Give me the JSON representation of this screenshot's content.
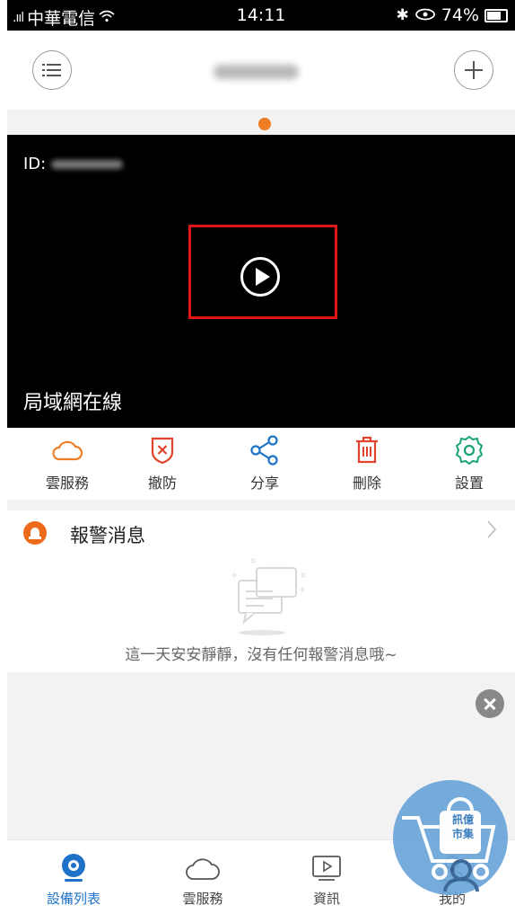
{
  "status_bar": {
    "carrier": "中華電信",
    "time": "14:11",
    "battery": "74%"
  },
  "video": {
    "id_label": "ID:",
    "status": "局域網在線"
  },
  "actions": [
    {
      "label": "雲服務",
      "icon": "cloud-icon"
    },
    {
      "label": "撤防",
      "icon": "shield-x-icon"
    },
    {
      "label": "分享",
      "icon": "share-icon"
    },
    {
      "label": "刪除",
      "icon": "trash-icon"
    },
    {
      "label": "設置",
      "icon": "settings-icon"
    }
  ],
  "alarm": {
    "title": "報警消息",
    "empty_text": "這一天安安靜靜，沒有任何報警消息哦~"
  },
  "market": {
    "line1": "訊億",
    "line2": "市集"
  },
  "tabs": [
    {
      "label": "設備列表",
      "icon": "camera-icon",
      "active": true
    },
    {
      "label": "雲服務",
      "icon": "cloud-icon"
    },
    {
      "label": "資訊",
      "icon": "video-play-icon"
    },
    {
      "label": "我的",
      "icon": "user-icon"
    }
  ],
  "colors": {
    "accent_orange": "#ee7d24",
    "accent_blue": "#1e73c8",
    "accent_red": "#e2432f",
    "accent_green": "#1aa37a"
  }
}
